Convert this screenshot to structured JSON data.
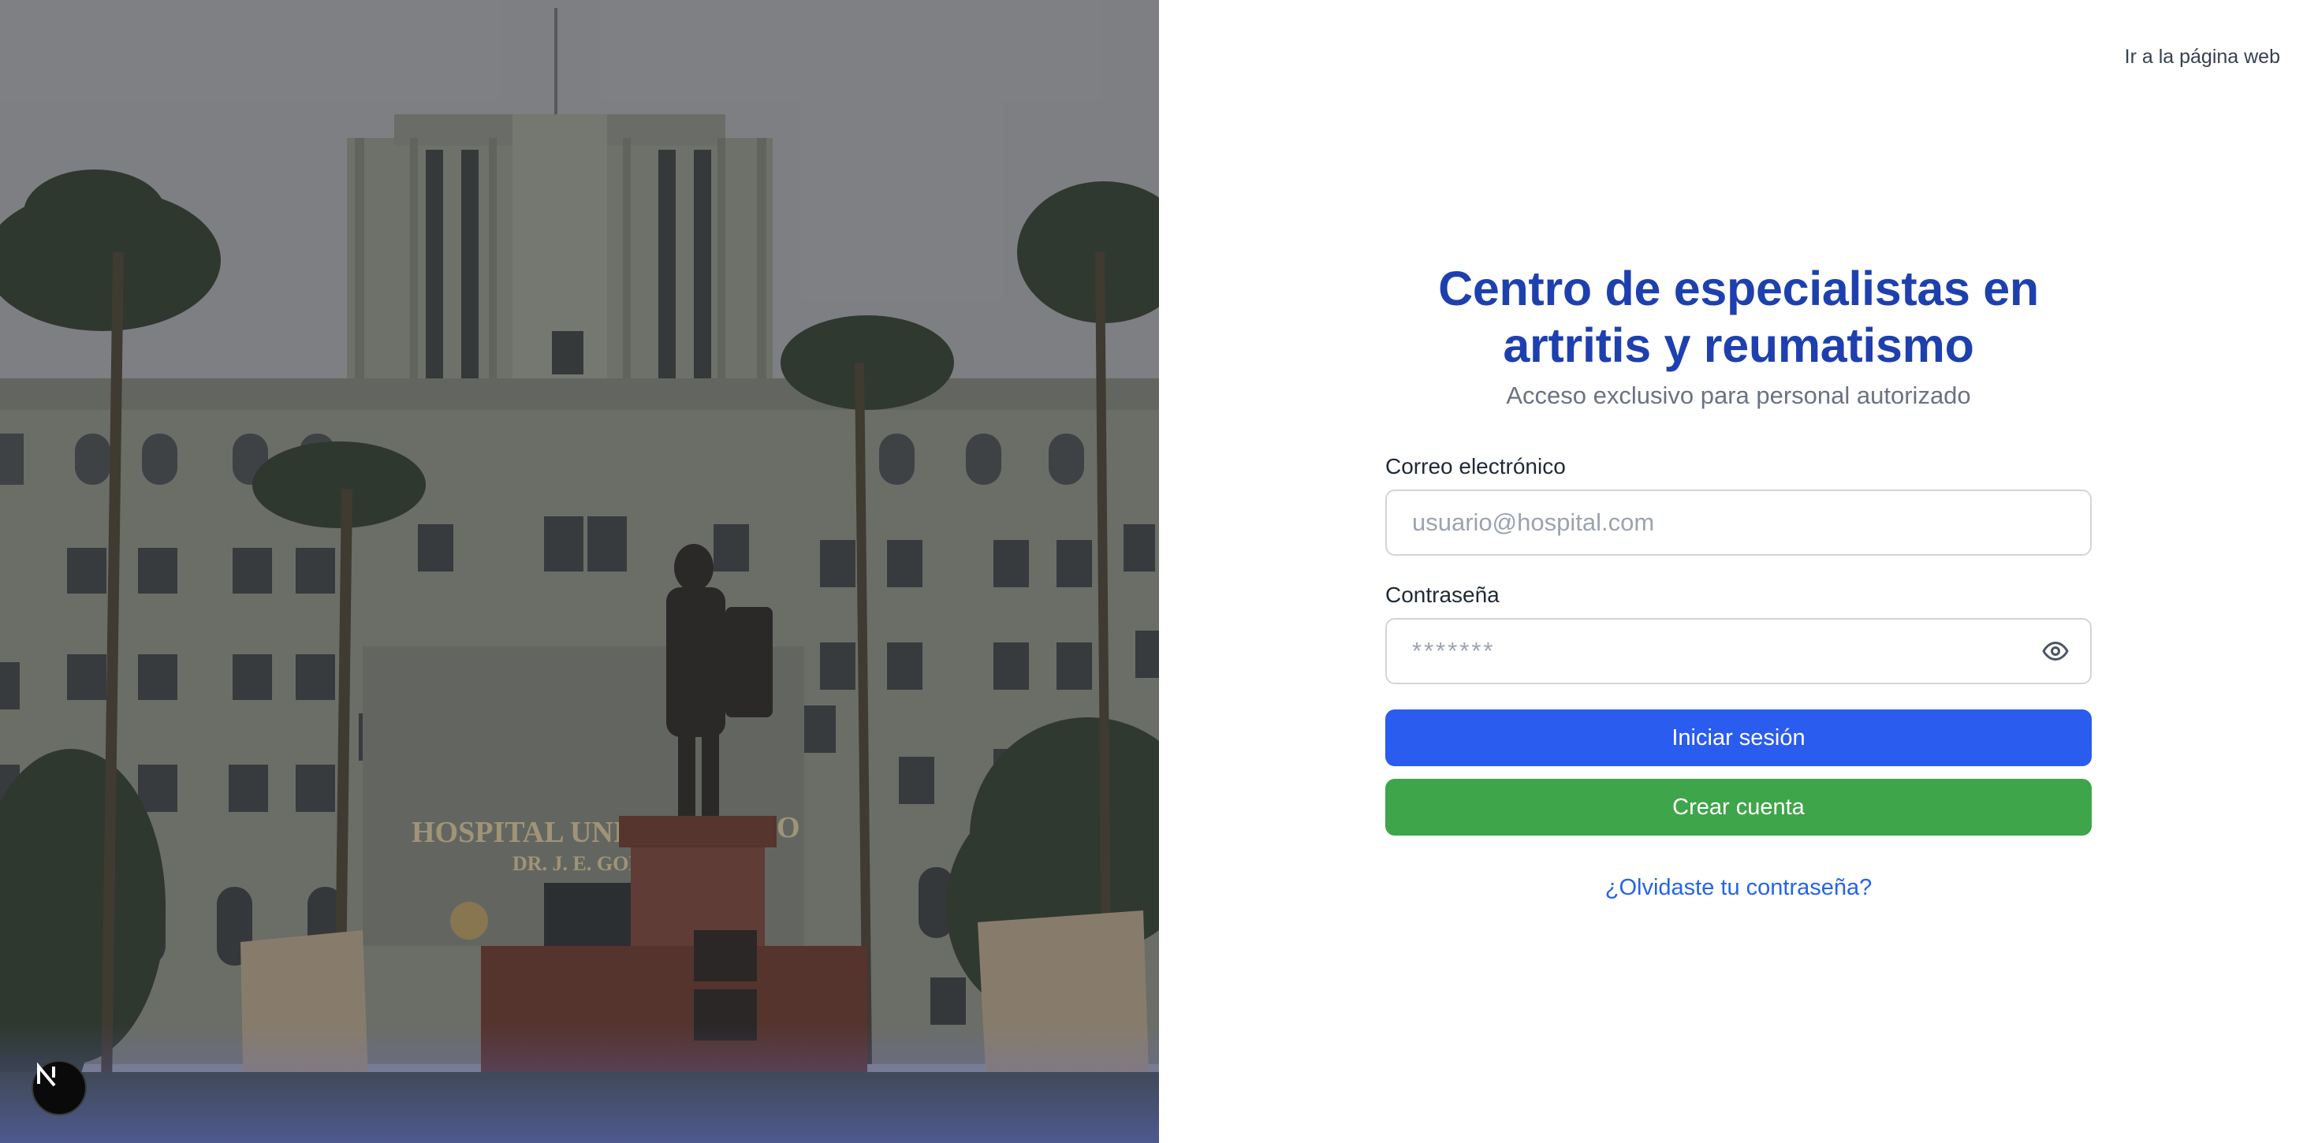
{
  "header": {
    "web_link_label": "Ir a la página web"
  },
  "login": {
    "title": "Centro de especialistas en artritis y reumatismo",
    "subtitle": "Acceso exclusivo para personal autorizado",
    "email": {
      "label": "Correo electrónico",
      "placeholder": "usuario@hospital.com",
      "value": ""
    },
    "password": {
      "label": "Contraseña",
      "placeholder": "*******",
      "value": "",
      "toggle_icon": "eye-icon"
    },
    "submit_label": "Iniciar sesión",
    "create_label": "Crear cuenta",
    "forgot_label": "¿Olvidaste tu contraseña?"
  },
  "photo": {
    "sign_line1": "HOSPITAL UNIVE",
    "sign_line1b": "O",
    "sign_line2": "DR. J. E. GON"
  },
  "badge": {
    "letter": "N",
    "icon": "next-logo-icon"
  },
  "colors": {
    "title": "#1e40af",
    "primary_button": "#2b5cf0",
    "secondary_button": "#3fa54a",
    "link": "#2563eb"
  }
}
